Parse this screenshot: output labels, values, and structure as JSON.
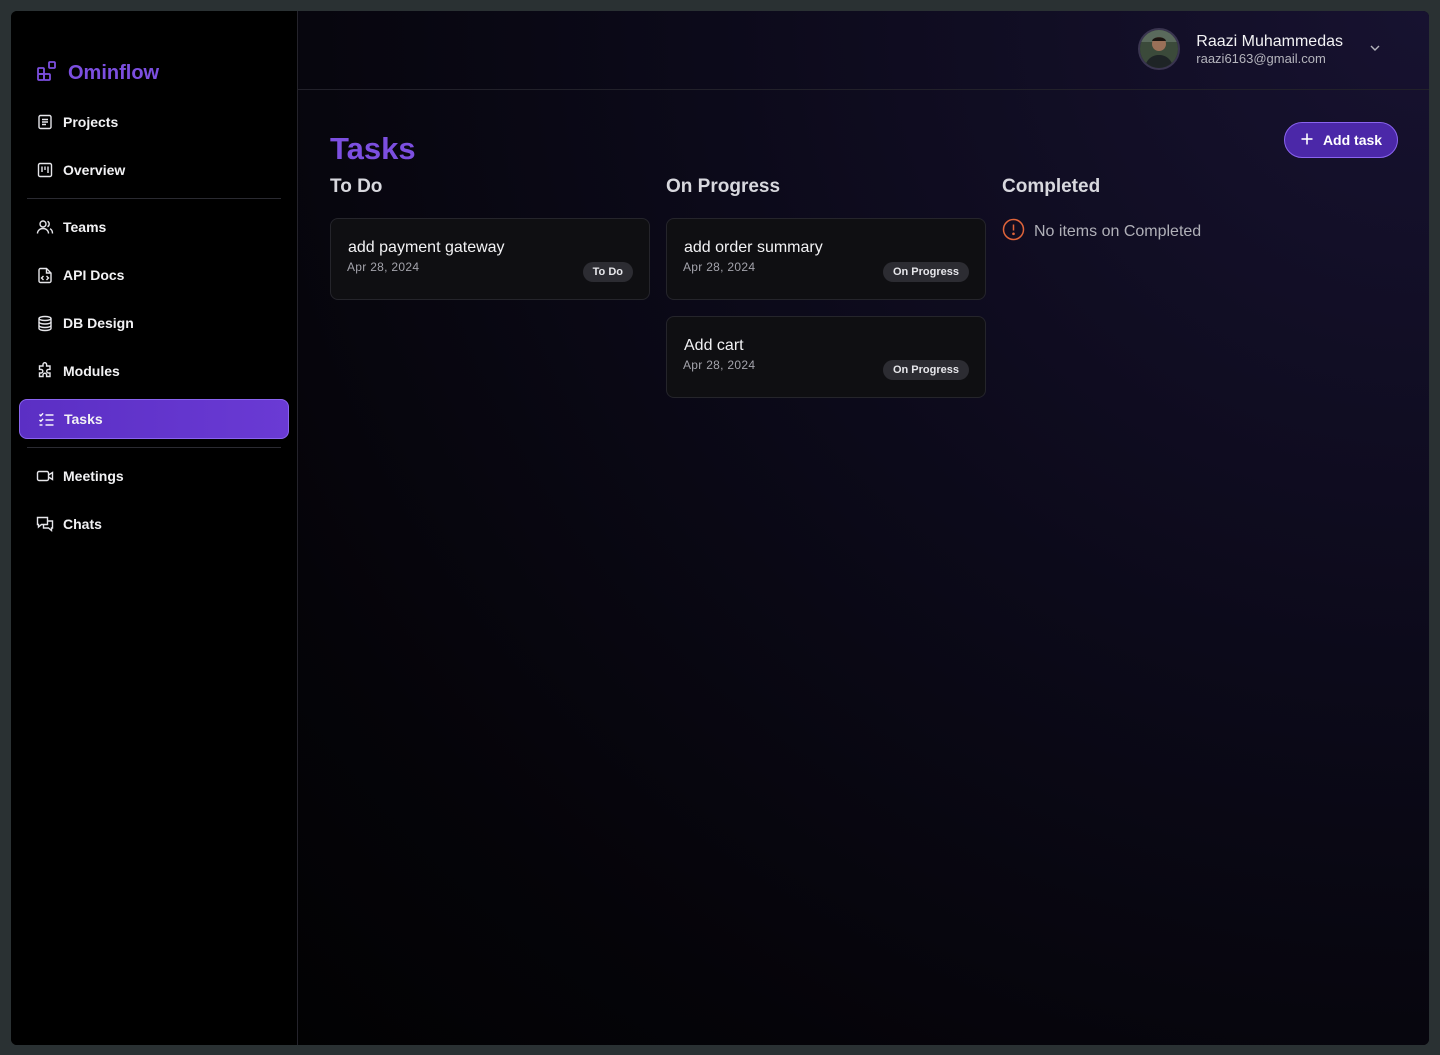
{
  "brand": {
    "name": "Ominflow",
    "accent": "#7c4fe0"
  },
  "sidebar": {
    "items": [
      {
        "label": "Projects",
        "icon": "document-icon"
      },
      {
        "label": "Overview",
        "icon": "kanban-icon"
      },
      {
        "label": "Teams",
        "icon": "users-icon"
      },
      {
        "label": "API Docs",
        "icon": "code-file-icon"
      },
      {
        "label": "DB Design",
        "icon": "database-icon"
      },
      {
        "label": "Modules",
        "icon": "puzzle-icon"
      },
      {
        "label": "Tasks",
        "icon": "checklist-icon",
        "active": true
      },
      {
        "label": "Meetings",
        "icon": "video-icon"
      },
      {
        "label": "Chats",
        "icon": "chat-icon"
      }
    ]
  },
  "user": {
    "name": "Raazi Muhammedas",
    "email": "raazi6163@gmail.com"
  },
  "page": {
    "title": "Tasks",
    "add_button": "Add task"
  },
  "columns": [
    {
      "title": "To Do",
      "cards": [
        {
          "title": "add payment gateway",
          "date": "Apr 28, 2024",
          "status": "To Do"
        }
      ]
    },
    {
      "title": "On Progress",
      "cards": [
        {
          "title": "add order summary",
          "date": "Apr 28, 2024",
          "status": "On Progress"
        },
        {
          "title": "Add cart",
          "date": "Apr 28, 2024",
          "status": "On Progress"
        }
      ]
    },
    {
      "title": "Completed",
      "cards": [],
      "empty_text": "No items on Completed"
    }
  ],
  "colors": {
    "accent": "#7c4fe0",
    "active_nav": "#5b2fc4",
    "warning": "#e0643a"
  }
}
